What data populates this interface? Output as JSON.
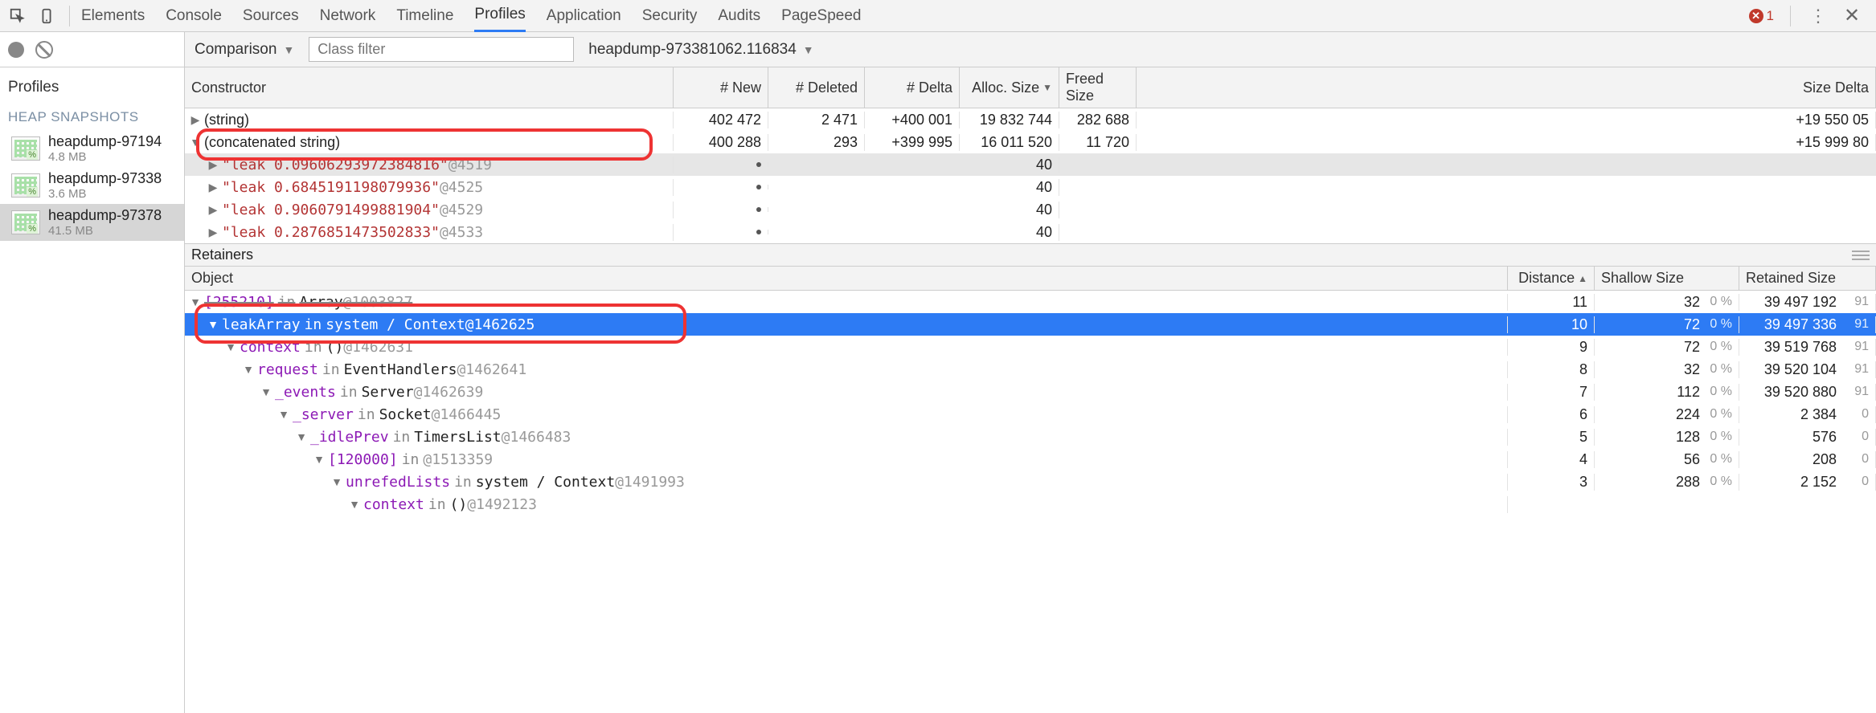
{
  "tabs": [
    "Elements",
    "Console",
    "Sources",
    "Network",
    "Timeline",
    "Profiles",
    "Application",
    "Security",
    "Audits",
    "PageSpeed"
  ],
  "activeTab": "Profiles",
  "errorCount": "1",
  "sidebar": {
    "title": "Profiles",
    "section": "HEAP SNAPSHOTS",
    "items": [
      {
        "name": "heapdump-97194",
        "size": "4.8 MB"
      },
      {
        "name": "heapdump-97338",
        "size": "3.6 MB"
      },
      {
        "name": "heapdump-97378",
        "size": "41.5 MB"
      }
    ]
  },
  "filter": {
    "mode": "Comparison",
    "placeholder": "Class filter",
    "compareTo": "heapdump-973381062.116834"
  },
  "topTable": {
    "headers": [
      "Constructor",
      "# New",
      "# Deleted",
      "# Delta",
      "Alloc. Size",
      "Freed Size",
      "Size Delta"
    ],
    "rows": [
      {
        "indent": 0,
        "toggle": "▶",
        "label": "(string)",
        "new": "402 472",
        "del": "2 471",
        "delta": "+400 001",
        "alloc": "19 832 744",
        "freed": "282 688",
        "sdelta": "+19 550 05"
      },
      {
        "indent": 0,
        "toggle": "▼",
        "label": "(concatenated string)",
        "new": "400 288",
        "del": "293",
        "delta": "+399 995",
        "alloc": "16 011 520",
        "freed": "11 720",
        "sdelta": "+15 999 80"
      },
      {
        "indent": 1,
        "toggle": "▶",
        "leak": "\"leak 0.09606293972384816\"",
        "id": "@4519",
        "new": "•",
        "del": "",
        "delta": "",
        "alloc": "40",
        "freed": "",
        "sdelta": "",
        "sel": true
      },
      {
        "indent": 1,
        "toggle": "▶",
        "leak": "\"leak 0.6845191198079936\"",
        "id": "@4525",
        "new": "•",
        "del": "",
        "delta": "",
        "alloc": "40",
        "freed": "",
        "sdelta": ""
      },
      {
        "indent": 1,
        "toggle": "▶",
        "leak": "\"leak 0.9060791499881904\"",
        "id": "@4529",
        "new": "•",
        "del": "",
        "delta": "",
        "alloc": "40",
        "freed": "",
        "sdelta": ""
      },
      {
        "indent": 1,
        "toggle": "▶",
        "leak": "\"leak 0.2876851473502833\"",
        "id": "@4533",
        "new": "•",
        "del": "",
        "delta": "",
        "alloc": "40",
        "freed": "",
        "sdelta": ""
      }
    ]
  },
  "retainers": {
    "title": "Retainers",
    "headers": [
      "Object",
      "Distance",
      "Shallow Size",
      "Retained Size"
    ],
    "rows": [
      {
        "indent": 0,
        "toggle": "▼",
        "pre": "[255210]",
        "kw": "in",
        "cls": "Array",
        "id": "@1003827",
        "dist": "11",
        "shal": "32",
        "shalp": "0 %",
        "ret": "39 497 192",
        "retp": "91",
        "strike": true
      },
      {
        "indent": 1,
        "toggle": "▼",
        "pre": "leakArray",
        "kw": "in",
        "cls": "system / Context",
        "id": "@1462625",
        "dist": "10",
        "shal": "72",
        "shalp": "0 %",
        "ret": "39 497 336",
        "retp": "91",
        "selblue": true
      },
      {
        "indent": 2,
        "toggle": "▼",
        "pre": "context",
        "kw": "in",
        "cls": "()",
        "id": "@1462631",
        "dist": "9",
        "shal": "72",
        "shalp": "0 %",
        "ret": "39 519 768",
        "retp": "91"
      },
      {
        "indent": 3,
        "toggle": "▼",
        "pre": "request",
        "kw": "in",
        "cls": "EventHandlers",
        "id": "@1462641",
        "dist": "8",
        "shal": "32",
        "shalp": "0 %",
        "ret": "39 520 104",
        "retp": "91"
      },
      {
        "indent": 4,
        "toggle": "▼",
        "pre": "_events",
        "kw": "in",
        "cls": "Server",
        "id": "@1462639",
        "dist": "7",
        "shal": "112",
        "shalp": "0 %",
        "ret": "39 520 880",
        "retp": "91"
      },
      {
        "indent": 5,
        "toggle": "▼",
        "pre": "_server",
        "kw": "in",
        "cls": "Socket",
        "id": "@1466445",
        "dist": "6",
        "shal": "224",
        "shalp": "0 %",
        "ret": "2 384",
        "retp": "0"
      },
      {
        "indent": 6,
        "toggle": "▼",
        "pre": "_idlePrev",
        "kw": "in",
        "cls": "TimersList",
        "id": "@1466483",
        "dist": "5",
        "shal": "128",
        "shalp": "0 %",
        "ret": "576",
        "retp": "0"
      },
      {
        "indent": 7,
        "toggle": "▼",
        "pre": "[120000]",
        "kw": "in",
        "cls": "",
        "id": "@1513359",
        "dist": "4",
        "shal": "56",
        "shalp": "0 %",
        "ret": "208",
        "retp": "0"
      },
      {
        "indent": 8,
        "toggle": "▼",
        "pre": "unrefedLists",
        "kw": "in",
        "cls": "system / Context",
        "id": "@1491993",
        "dist": "3",
        "shal": "288",
        "shalp": "0 %",
        "ret": "2 152",
        "retp": "0"
      },
      {
        "indent": 9,
        "toggle": "▼",
        "pre": "context",
        "kw": "in",
        "cls": "()",
        "id": "@1492123",
        "dist": "",
        "shal": "",
        "shalp": "",
        "ret": "",
        "retp": ""
      }
    ]
  }
}
